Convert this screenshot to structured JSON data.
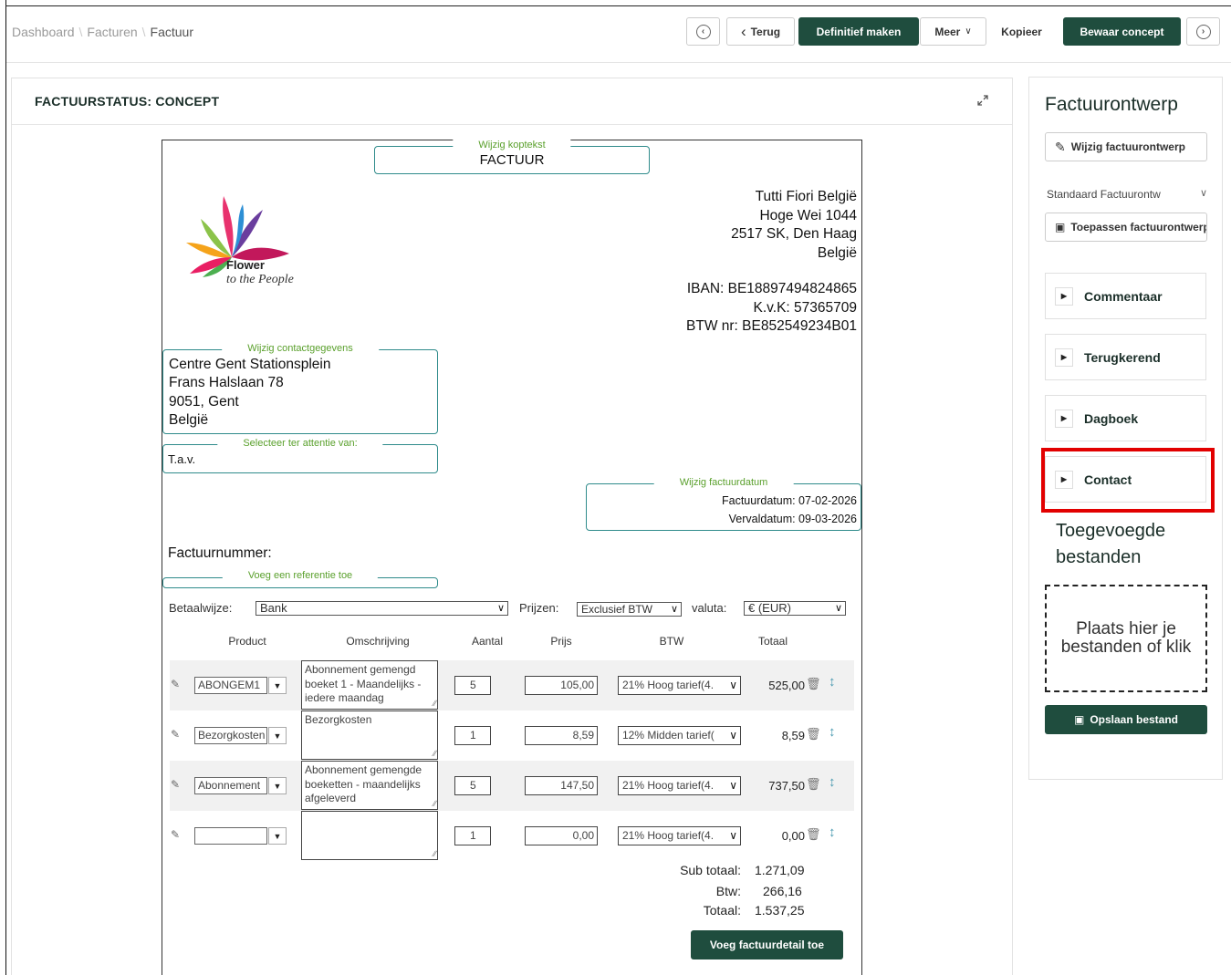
{
  "breadcrumb": [
    "Dashboard",
    "Facturen",
    "Factuur"
  ],
  "toolbar": {
    "back": "Terug",
    "finalize": "Definitief maken",
    "more": "Meer",
    "copy": "Kopieer",
    "save_draft": "Bewaar concept"
  },
  "status": {
    "title": "FACTUURSTATUS: CONCEPT"
  },
  "invoice": {
    "header_legend": "Wijzig koptekst",
    "header_title": "FACTUUR",
    "logo": {
      "line1": "Flower",
      "line2": "to the People"
    },
    "company": [
      "Tutti Fiori België",
      "Hoge Wei 1044",
      "2517 SK, Den Haag",
      "België"
    ],
    "company_ids": [
      "IBAN: BE18897494824865",
      "K.v.K: 57365709",
      "BTW nr: BE852549234B01"
    ],
    "contact_legend": "Wijzig contactgegevens",
    "contact": [
      "Centre Gent Stationsplein",
      "Frans Halslaan 78",
      "9051, Gent",
      "België"
    ],
    "attention_legend": "Selecteer ter attentie van:",
    "attention_value": "T.a.v.",
    "date_legend": "Wijzig factuurdatum",
    "invoice_date": "Factuurdatum: 07-02-2026",
    "due_date": "Vervaldatum: 09-03-2026",
    "number_label": "Factuurnummer:",
    "reference_legend": "Voeg een referentie toe",
    "payment_label": "Betaalwijze:",
    "payment_value": "Bank",
    "prices_label": "Prijzen:",
    "prices_value": "Exclusief BTW",
    "currency_label": "valuta:",
    "currency_value": "€ (EUR)",
    "columns": [
      "Product",
      "Omschrijving",
      "Aantal",
      "Prijs",
      "BTW",
      "Totaal"
    ],
    "rows": [
      {
        "product": "ABONGEM1",
        "description": "Abonnement gemengd boeket 1 - Maandelijks - iedere maandag",
        "qty": "5",
        "price": "105,00",
        "vat": "21% Hoog tarief(4.",
        "total": "525,00"
      },
      {
        "product": "Bezorgkosten",
        "description": "Bezorgkosten",
        "qty": "1",
        "price": "8,59",
        "vat": "12% Midden tarief(",
        "total": "8,59"
      },
      {
        "product": "Abonnement",
        "description": "Abonnement gemengde boeketten - maandelijks afgeleverd",
        "qty": "5",
        "price": "147,50",
        "vat": "21% Hoog tarief(4.",
        "total": "737,50"
      },
      {
        "product": "",
        "description": "",
        "qty": "1",
        "price": "0,00",
        "vat": "21% Hoog tarief(4.",
        "total": "0,00"
      }
    ],
    "subtotal_label": "Sub totaal:",
    "subtotal_value": "1.271,09",
    "vat_label": "Btw:",
    "vat_value": "266,16",
    "total_label": "Totaal:",
    "total_value": "1.537,25",
    "add_detail": "Voeg factuurdetail toe"
  },
  "side": {
    "title": "Factuurontwerp",
    "edit_design": "Wijzig factuurontwerp",
    "design_select": "Standaard Factuurontw",
    "apply_design": "Toepassen factuurontwerp",
    "sections": [
      "Commentaar",
      "Terugkerend",
      "Dagboek",
      "Contact"
    ],
    "files_title": "Toegevoegde bestanden",
    "dropzone": "Plaats hier je bestanden of klik",
    "save_file": "Opslaan bestand"
  },
  "colors": {
    "primary": "#1f4d3e",
    "fieldset": "#2f8b8b",
    "legend": "#5aa02c",
    "highlight": "#e20000"
  },
  "icons": [
    "circle-left-icon",
    "chevron-left-icon",
    "chevron-down-icon",
    "circle-right-icon",
    "expand-icon",
    "edit-icon",
    "trash-icon",
    "updown-arrow-icon",
    "caret-right-icon",
    "save-icon",
    "pencil-square-icon"
  ]
}
